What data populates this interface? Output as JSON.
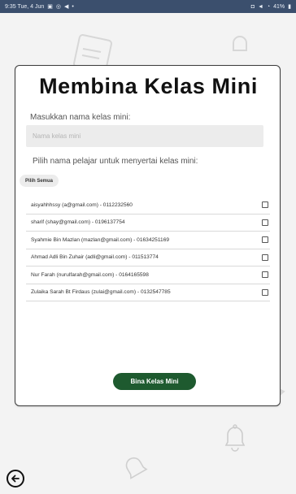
{
  "status_bar": {
    "time_date": "9:35  Tue, 4 Jun",
    "battery": "41%"
  },
  "page": {
    "title": "Membina Kelas Mini",
    "class_name_label": "Masukkan nama kelas mini:",
    "class_name_placeholder": "Nama kelas mini",
    "class_name_value": "",
    "students_label": "Pilih nama pelajar untuk menyertai kelas mini:",
    "select_all_label": "Pilih Semua",
    "submit_label": "Bina Kelas Mini"
  },
  "students": [
    {
      "label": "aisyahhhssy (a@gmail.com) - 0112232560",
      "checked": false
    },
    {
      "label": "sharif (shay@gmail.com) - 0196137754",
      "checked": false
    },
    {
      "label": "Syahmie Bin Mazlan (mazlan@gmail.com) - 01634251169",
      "checked": false
    },
    {
      "label": "Ahmad Adli Bin Zuhair (adli@gmail.com) - 011513774",
      "checked": false
    },
    {
      "label": "Nur Farah (nurulfarah@gmail.com) - 0164165598",
      "checked": false
    },
    {
      "label": "Zulaika Sarah Bt Firdaus (zulai@gmail.com) - 0132547785",
      "checked": false
    }
  ],
  "colors": {
    "primary_button": "#1e5a2f",
    "status_bar": "#3b4f6d",
    "background": "#f3f3f3"
  },
  "icons": {
    "back": "back-arrow-icon",
    "background_decorations": [
      "document-icon",
      "bell-icon"
    ]
  }
}
